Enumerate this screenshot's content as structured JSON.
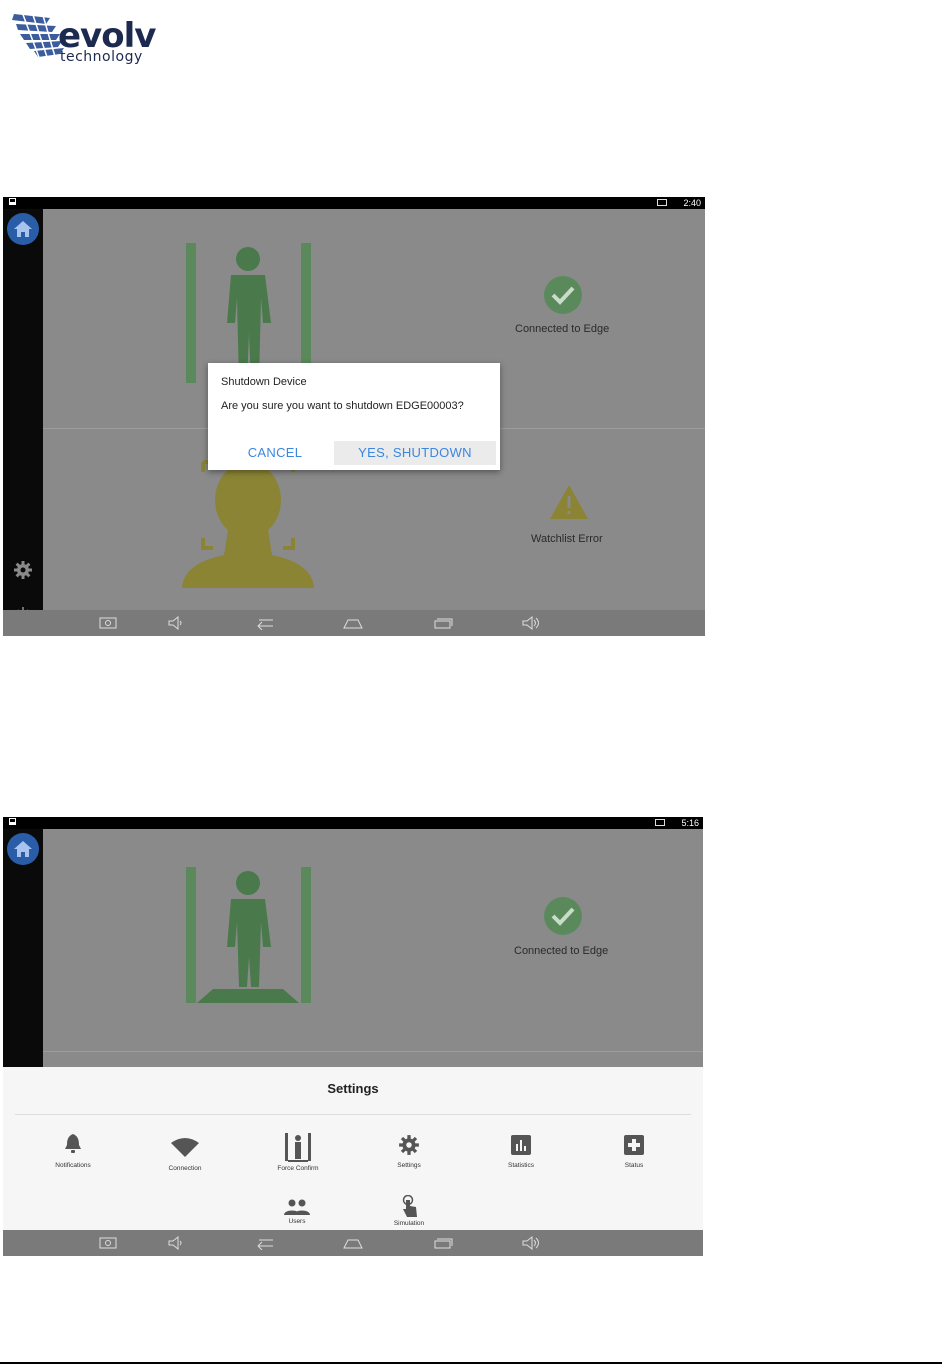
{
  "logo": {
    "word": "evolv",
    "subword": "technology"
  },
  "screen1": {
    "status_time": "2:40",
    "right_top_label": "Connected to Edge",
    "right_bottom_label": "Watchlist Error",
    "dialog": {
      "title": "Shutdown Device",
      "message": "Are you sure you want to shutdown EDGE00003?",
      "cancel_label": "CANCEL",
      "confirm_label": "YES, SHUTDOWN"
    }
  },
  "screen2": {
    "status_time": "5:16",
    "right_top_label": "Connected to Edge",
    "settings": {
      "title": "Settings",
      "items": [
        {
          "label": "Notifications",
          "icon": "bell-icon"
        },
        {
          "label": "Connection",
          "icon": "wifi-icon"
        },
        {
          "label": "Force Confirm",
          "icon": "portal-icon"
        },
        {
          "label": "Settings",
          "icon": "gear-icon"
        },
        {
          "label": "Statistics",
          "icon": "bar-chart-icon"
        },
        {
          "label": "Status",
          "icon": "plus-box-icon"
        },
        {
          "label": "Users",
          "icon": "users-icon"
        },
        {
          "label": "Simulation",
          "icon": "touch-icon"
        }
      ]
    }
  },
  "colors": {
    "accent_blue": "#3a86e0",
    "ok_green": "#5a8a5c",
    "warn_olive": "#8a8434",
    "home_blue": "#2a5da8"
  }
}
